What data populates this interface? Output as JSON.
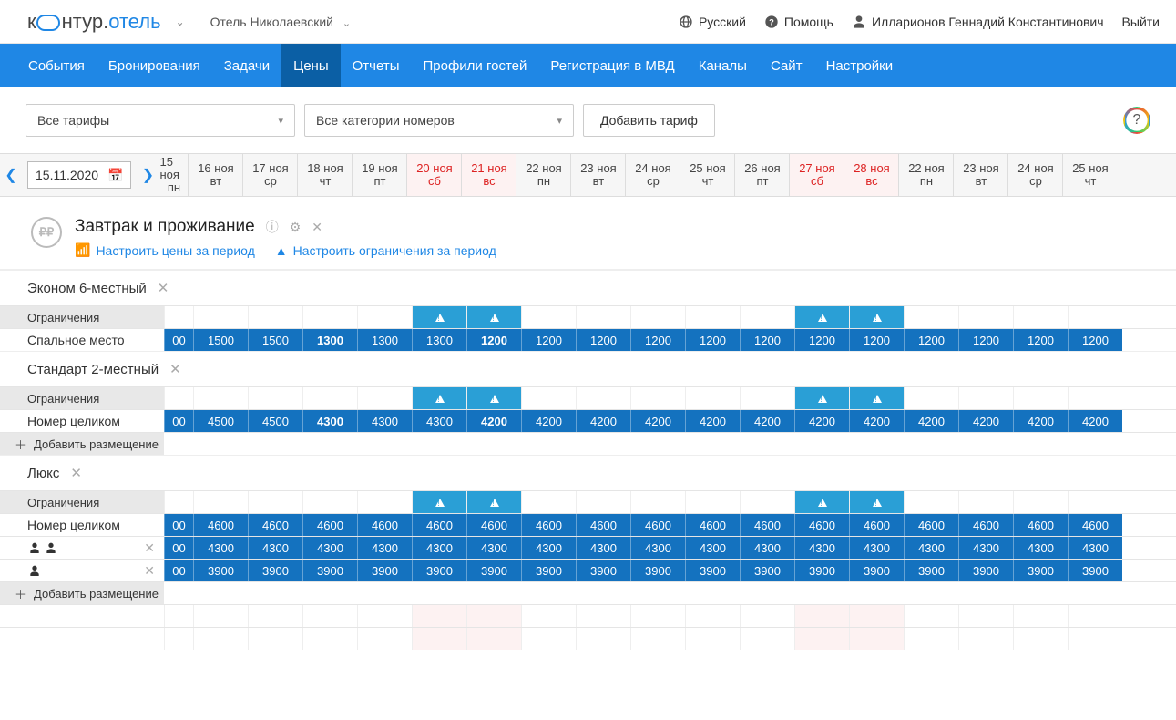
{
  "header": {
    "brand1": "к",
    "brand2": "нтур.",
    "brand3": "отель",
    "hotel": "Отель Николаевский",
    "lang": "Русский",
    "help": "Помощь",
    "user": "Илларионов Геннадий Константинович",
    "logout": "Выйти"
  },
  "nav": [
    "События",
    "Бронирования",
    "Задачи",
    "Цены",
    "Отчеты",
    "Профили гостей",
    "Регистрация в МВД",
    "Каналы",
    "Сайт",
    "Настройки"
  ],
  "nav_active": 3,
  "toolbar": {
    "tariffs": "Все тарифы",
    "categories": "Все категории номеров",
    "add_tariff": "Добавить тариф"
  },
  "date": "15.11.2020",
  "days": [
    {
      "d": "15 ноя",
      "w": "пн",
      "we": false,
      "first": true
    },
    {
      "d": "16 ноя",
      "w": "вт",
      "we": false
    },
    {
      "d": "17 ноя",
      "w": "ср",
      "we": false
    },
    {
      "d": "18 ноя",
      "w": "чт",
      "we": false
    },
    {
      "d": "19 ноя",
      "w": "пт",
      "we": false
    },
    {
      "d": "20 ноя",
      "w": "сб",
      "we": true
    },
    {
      "d": "21 ноя",
      "w": "вс",
      "we": true
    },
    {
      "d": "22 ноя",
      "w": "пн",
      "we": false
    },
    {
      "d": "23 ноя",
      "w": "вт",
      "we": false
    },
    {
      "d": "24 ноя",
      "w": "ср",
      "we": false
    },
    {
      "d": "25 ноя",
      "w": "чт",
      "we": false
    },
    {
      "d": "26 ноя",
      "w": "пт",
      "we": false
    },
    {
      "d": "27 ноя",
      "w": "сб",
      "we": true
    },
    {
      "d": "28 ноя",
      "w": "вс",
      "we": true
    },
    {
      "d": "22 ноя",
      "w": "пн",
      "we": false
    },
    {
      "d": "23 ноя",
      "w": "вт",
      "we": false
    },
    {
      "d": "24 ноя",
      "w": "ср",
      "we": false
    },
    {
      "d": "25 ноя",
      "w": "чт",
      "we": false
    }
  ],
  "tariff": {
    "title": "Завтрак и проживание",
    "link_prices": "Настроить цены за период",
    "link_restr": "Настроить ограничения за период"
  },
  "labels": {
    "restrictions": "Ограничения",
    "add_placement": "Добавить размещение"
  },
  "warn_cols": [
    5,
    6,
    12,
    13
  ],
  "categories": [
    {
      "name": "Эконом 6-местный",
      "rows": [
        {
          "type": "restr"
        },
        {
          "type": "price",
          "label": "Спальное место",
          "cells": [
            "00",
            "1500",
            "1500",
            "1300",
            "1300",
            "1300",
            "1200",
            "1200",
            "1200",
            "1200",
            "1200",
            "1200",
            "1200",
            "1200",
            "1200",
            "1200",
            "1200",
            "1200"
          ],
          "bold": [
            3,
            6
          ]
        }
      ]
    },
    {
      "name": "Стандарт 2-местный",
      "rows": [
        {
          "type": "restr"
        },
        {
          "type": "price",
          "label": "Номер целиком",
          "cells": [
            "00",
            "4500",
            "4500",
            "4300",
            "4300",
            "4300",
            "4200",
            "4200",
            "4200",
            "4200",
            "4200",
            "4200",
            "4200",
            "4200",
            "4200",
            "4200",
            "4200",
            "4200"
          ],
          "bold": [
            3,
            6
          ]
        },
        {
          "type": "add"
        }
      ]
    },
    {
      "name": "Люкс",
      "rows": [
        {
          "type": "restr"
        },
        {
          "type": "price",
          "label": "Номер целиком",
          "cells": [
            "00",
            "4600",
            "4600",
            "4600",
            "4600",
            "4600",
            "4600",
            "4600",
            "4600",
            "4600",
            "4600",
            "4600",
            "4600",
            "4600",
            "4600",
            "4600",
            "4600",
            "4600"
          ]
        },
        {
          "type": "price",
          "persons": 2,
          "closable": true,
          "cells": [
            "00",
            "4300",
            "4300",
            "4300",
            "4300",
            "4300",
            "4300",
            "4300",
            "4300",
            "4300",
            "4300",
            "4300",
            "4300",
            "4300",
            "4300",
            "4300",
            "4300",
            "4300"
          ]
        },
        {
          "type": "price",
          "persons": 1,
          "closable": true,
          "cells": [
            "00",
            "3900",
            "3900",
            "3900",
            "3900",
            "3900",
            "3900",
            "3900",
            "3900",
            "3900",
            "3900",
            "3900",
            "3900",
            "3900",
            "3900",
            "3900",
            "3900",
            "3900"
          ]
        },
        {
          "type": "add"
        }
      ]
    }
  ],
  "extra_empty_rows": 2
}
